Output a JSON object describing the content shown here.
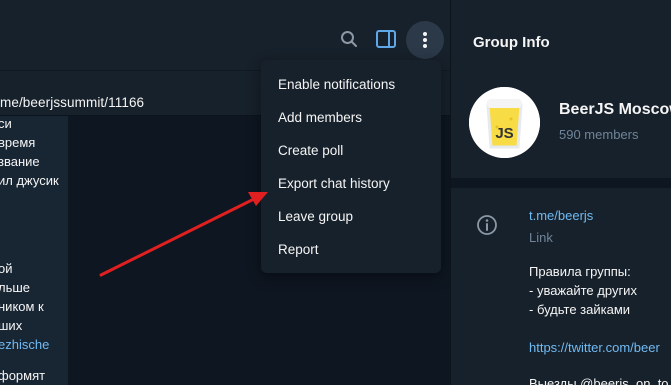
{
  "header": {
    "search_icon": "search-icon",
    "panel_icon": "side-panel-icon",
    "more_icon": "more-vertical-icon"
  },
  "pinned": {
    "text": "me/beerjssummit/11166"
  },
  "message": {
    "lines": [
      "си",
      "время",
      "звание",
      "ил джусик",
      "",
      "",
      "",
      "ой",
      "льше",
      "ником к",
      "ших",
      "ezhische",
      "",
      "формят"
    ]
  },
  "menu": {
    "items": [
      "Enable notifications",
      "Add members",
      "Create poll",
      "Export chat history",
      "Leave group",
      "Report"
    ]
  },
  "info_panel": {
    "title": "Group Info",
    "group_name": "BeerJS Moscow",
    "members": "590 members",
    "avatar_text": "JS",
    "link": "t.me/beerjs",
    "link_label": "Link",
    "description": [
      "Правила группы:",
      "- уважайте других",
      "- будьте зайками",
      "",
      "https://twitter.com/beer",
      "",
      "Выезды @beerjs_on_to"
    ]
  },
  "colors": {
    "background": "#0e1621",
    "panel": "#17212b",
    "accent": "#71baf2",
    "muted": "#708499",
    "annotation_arrow": "#e02020"
  }
}
